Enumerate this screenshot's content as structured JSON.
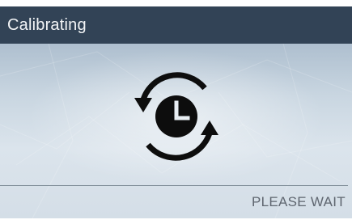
{
  "window": {
    "title": "Calibrating"
  },
  "content": {
    "icon": "calibrating-clock-icon",
    "status": "PLEASE WAIT"
  },
  "colors": {
    "title_bar": "#324356",
    "title_text": "#f2f4f6",
    "icon": "#0d0d0d",
    "status_text": "#5f6670",
    "divider": "#7d8a96"
  }
}
